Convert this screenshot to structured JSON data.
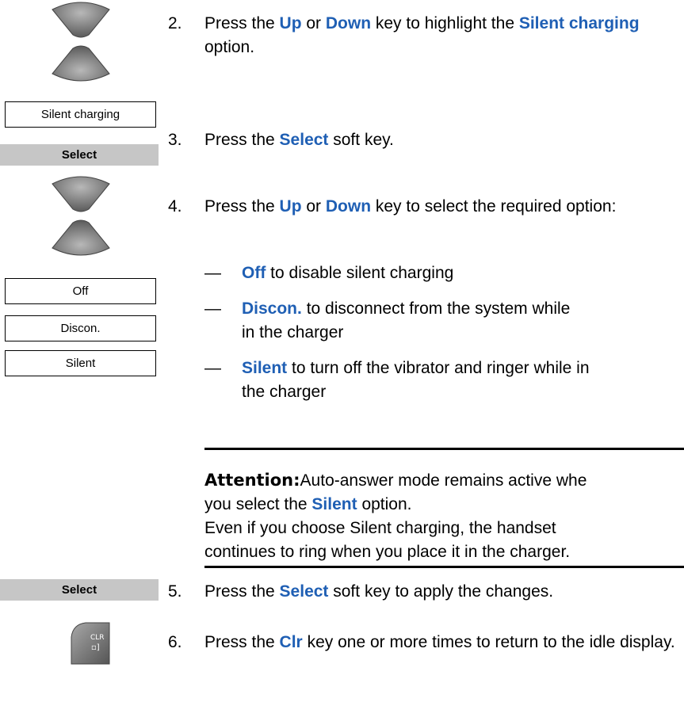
{
  "steps": [
    {
      "num": "2.",
      "parts": [
        "Press the ",
        "Up",
        " or ",
        "Down",
        " key to highlight the ",
        "Silent charging",
        " option."
      ]
    },
    {
      "num": "3.",
      "parts": [
        "Press the ",
        "Select",
        " soft key."
      ]
    },
    {
      "num": "4.",
      "parts": [
        "Press the ",
        "Up",
        " or ",
        "Down",
        " key to select the required option:"
      ]
    },
    {
      "num": "5.",
      "parts": [
        "Press the ",
        "Select",
        " soft key to apply the changes."
      ]
    },
    {
      "num": "6.",
      "parts": [
        "Press the ",
        "Clr",
        " key one or more times to return to the idle display."
      ]
    }
  ],
  "options": [
    {
      "dash": "—",
      "key": "Off",
      "text": " to disable silent charging"
    },
    {
      "dash": "—",
      "key": "Discon.",
      "text_line1": " to disconnect from the system while",
      "text_line2": "in the charger"
    },
    {
      "dash": "—",
      "key": "Silent",
      "text_line1": " to turn off the vibrator and ringer while in",
      "text_line2": "the charger"
    }
  ],
  "attention": {
    "label": "Attention:",
    "line1_text": "Auto-answer mode remains active whe",
    "line2_pre": "you select the ",
    "line2_key": "Silent",
    "line2_post": " option.",
    "line3": "Even if you choose Silent charging, the handset",
    "line4": "continues to ring when you place it in the charger."
  },
  "screens": {
    "silent_charging": "Silent charging",
    "off": "Off",
    "discon": "Discon.",
    "silent": "Silent"
  },
  "softkeys": {
    "select_1": "Select",
    "select_2": "Select"
  },
  "clr_key": {
    "line1": "CLR",
    "line2": "▫]"
  },
  "colors": {
    "keyword": "#1f5fb4",
    "softkey_bg": "#c6c6c6"
  }
}
